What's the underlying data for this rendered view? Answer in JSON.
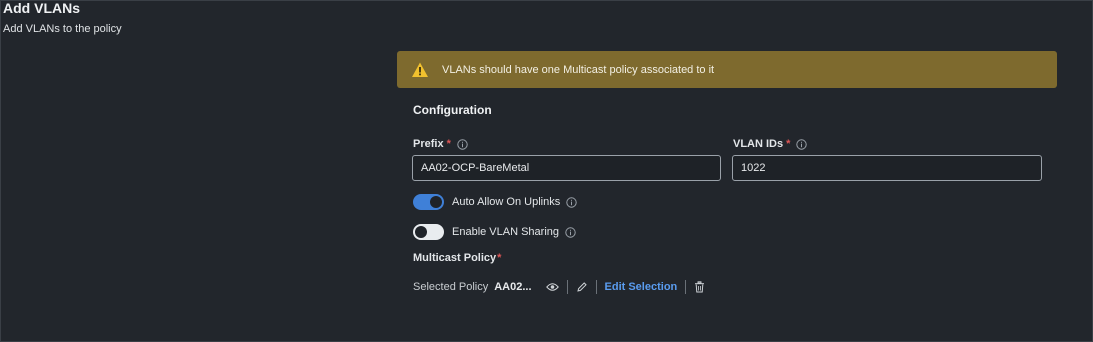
{
  "header": {
    "title": "Add VLANs",
    "subtitle": "Add VLANs to the policy"
  },
  "warning": {
    "text": "VLANs should have one Multicast policy associated to it",
    "icon": "warning-triangle-icon"
  },
  "configuration": {
    "title": "Configuration",
    "prefix": {
      "label": "Prefix",
      "value": "AA02-OCP-BareMetal"
    },
    "vlan_ids": {
      "label": "VLAN IDs",
      "value": "1022"
    },
    "required_marker": "*",
    "auto_allow": {
      "label": "Auto Allow On Uplinks",
      "enabled": true
    },
    "vlan_sharing": {
      "label": "Enable VLAN Sharing",
      "enabled": false
    }
  },
  "multicast": {
    "title": "Multicast Policy",
    "selected_label": "Selected Policy",
    "selected_value": "AA02...",
    "edit_label": "Edit Selection"
  },
  "colors": {
    "background": "#22262c",
    "warning_bg": "#7e6a2e",
    "accent": "#3f80d8",
    "link": "#5a9cf0",
    "required": "#e05656"
  }
}
